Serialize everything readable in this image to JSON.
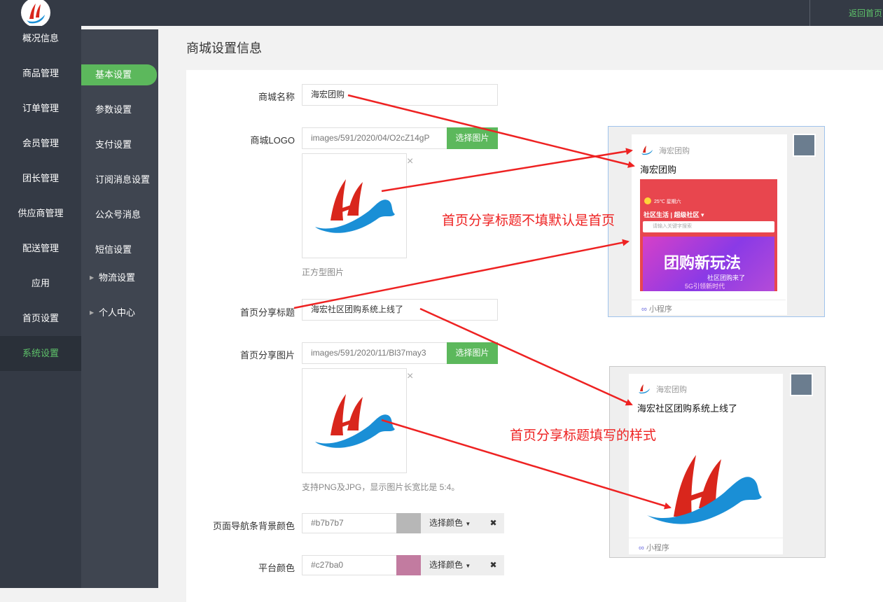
{
  "topbar": {
    "return_link": "返回首页"
  },
  "sidebar_main": [
    "概况信息",
    "商品管理",
    "订单管理",
    "会员管理",
    "团长管理",
    "供应商管理",
    "配送管理",
    "应用",
    "首页设置",
    "系统设置"
  ],
  "sidebar_sub": [
    "基本设置",
    "参数设置",
    "支付设置",
    "订阅消息设置",
    "公众号消息",
    "短信设置",
    "物流设置",
    "个人中心"
  ],
  "page": {
    "title": "商城设置信息"
  },
  "form": {
    "shop_name_label": "商城名称",
    "shop_name_value": "海宏团购",
    "logo_label": "商城LOGO",
    "logo_path": "images/591/2020/04/O2cZ14gP",
    "choose_image": "选择图片",
    "logo_hint": "正方型图片",
    "share_title_label": "首页分享标题",
    "share_title_value": "海宏社区团购系统上线了",
    "share_image_label": "首页分享图片",
    "share_image_path": "images/591/2020/11/Bl37may3",
    "share_image_hint": "支持PNG及JPG，显示图片长宽比是 5:4。",
    "nav_bg_label": "页面导航条背景颜色",
    "nav_bg_value": "#b7b7b7",
    "platform_color_label": "平台颜色",
    "platform_color_value": "#c27ba0",
    "choose_color": "选择颜色",
    "clear": "✖",
    "remove": "×"
  },
  "preview1": {
    "brand": "海宏团购",
    "title": "海宏团购",
    "weather": "25℃ 星期六",
    "community": "社区生活  |  超级社区 ▾",
    "search_placeholder": "请输入关键字搜索",
    "banner_main": "团购新玩法",
    "banner_sub": "社区团购来了",
    "banner_line": "5G引领新时代",
    "mini_program": "小程序"
  },
  "preview2": {
    "brand": "海宏团购",
    "title": "海宏社区团购系统上线了",
    "mini_program": "小程序"
  },
  "annotations": {
    "note1": "首页分享标题不填默认是首页",
    "note2": "首页分享标题填写的样式"
  },
  "colors": {
    "accent": "#5cb85c",
    "annotation": "#ee2222",
    "nav_bg": "#b7b7b7",
    "platform": "#c27ba0"
  }
}
